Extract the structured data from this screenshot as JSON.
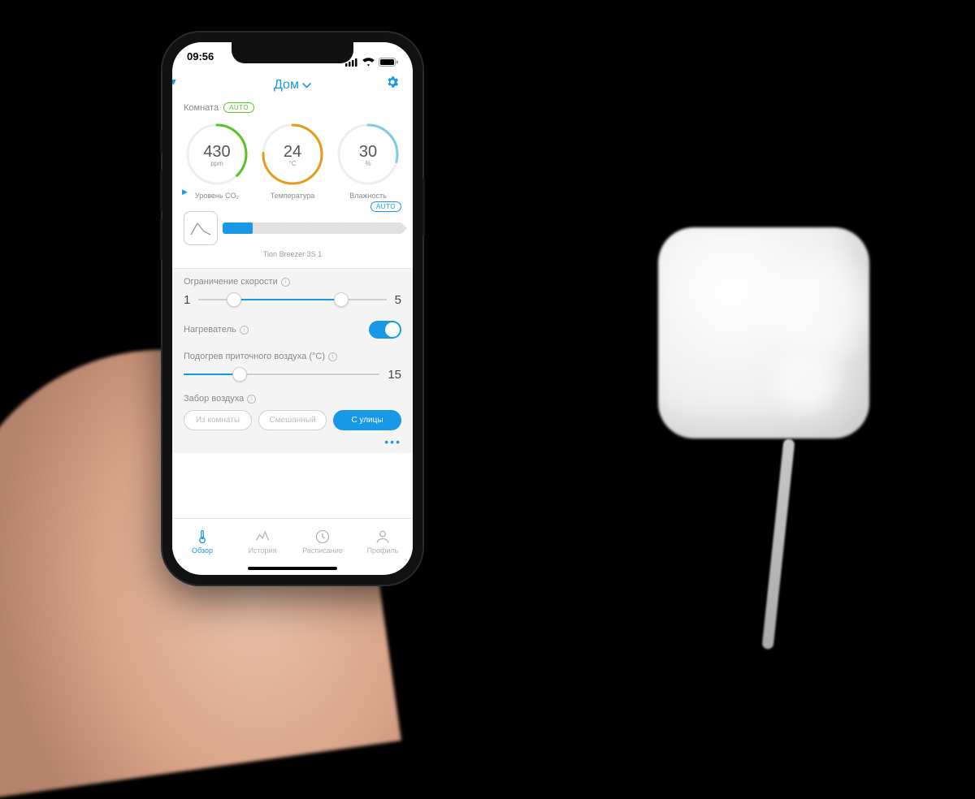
{
  "status": {
    "time": "09:56"
  },
  "header": {
    "title": "Дом"
  },
  "room": {
    "label": "Комната",
    "mode_badge": "AUTO"
  },
  "gauges": {
    "co2": {
      "value": "430",
      "unit": "ppm",
      "label": "Уровень CO₂"
    },
    "temp": {
      "value": "24",
      "unit": "°C",
      "label": "Температура"
    },
    "hum": {
      "value": "30",
      "unit": "%",
      "label": "Влажность"
    }
  },
  "device": {
    "mode_badge": "AUTO",
    "name": "Tion Breezer 3S 1"
  },
  "controls": {
    "speed_label": "Ограничение скорости",
    "speed_min": "1",
    "speed_max": "5",
    "heater_label": "Нагреватель",
    "heater_on": true,
    "heat_temp_label": "Подогрев приточного воздуха (°C)",
    "heat_temp_value": "15",
    "intake_label": "Забор воздуха",
    "intake": {
      "opt_room": "Из комнаты",
      "opt_mixed": "Смешанный",
      "opt_street": "С улицы"
    }
  },
  "tabs": {
    "overview": "Обзор",
    "history": "История",
    "schedule": "Расписание",
    "profile": "Профиль"
  }
}
